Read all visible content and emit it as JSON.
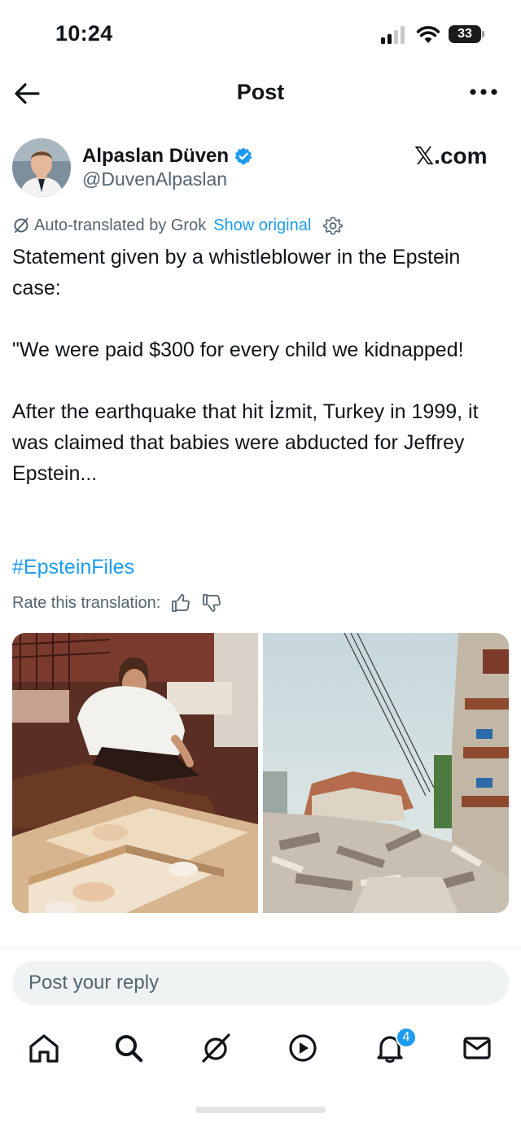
{
  "status_bar": {
    "time": "10:24",
    "battery": "33",
    "icons": [
      "signal-icon",
      "wifi-icon",
      "battery-icon"
    ]
  },
  "header": {
    "title": "Post",
    "icons": [
      "back-arrow-icon",
      "more-icon"
    ]
  },
  "author": {
    "name": "Alpaslan Düven",
    "handle": "@DuvenAlpaslan",
    "verified": true
  },
  "watermark": {
    "x": "𝕏",
    "text": ".com"
  },
  "translation": {
    "label": "Auto-translated by Grok",
    "show_original": "Show original",
    "rate_label": "Rate this translation:"
  },
  "post": {
    "text": "Statement given by a whistleblower in the Epstein case:\n\n\"We were paid $300 for every child we kidnapped!\n\nAfter the earthquake that hit İzmit, Turkey in 1999, it was claimed that babies were abducted for Jeffrey Epstein...",
    "hashtag": "#EpsteinFiles"
  },
  "media": {
    "images": [
      "photo-nursery",
      "photo-earthquake-rubble"
    ]
  },
  "reply": {
    "placeholder": "Post your reply"
  },
  "nav": {
    "items": [
      "home-icon",
      "search-icon",
      "grok-icon",
      "video-icon",
      "notifications-icon",
      "messages-icon"
    ],
    "notification_badge": "4"
  },
  "colors": {
    "accent": "#1d9bf0",
    "secondary_text": "#536471",
    "primary_text": "#0f1419",
    "reply_bg": "#eff3f4"
  }
}
